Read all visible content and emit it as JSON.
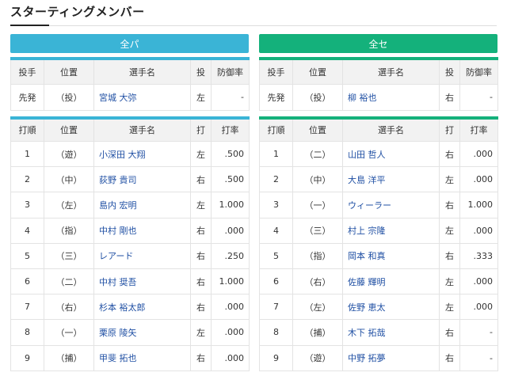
{
  "page": {
    "title": "スターティングメンバー"
  },
  "teams": [
    {
      "key": "pa",
      "name": "全パ",
      "pitcher": {
        "headers": [
          "投手",
          "位置",
          "選手名",
          "投",
          "防御率"
        ],
        "role": "先発",
        "position": "（投）",
        "name": "宮城 大弥",
        "throws": "左",
        "era": "-"
      },
      "batting": {
        "headers": [
          "打順",
          "位置",
          "選手名",
          "打",
          "打率"
        ],
        "rows": [
          {
            "order": "1",
            "position": "（遊）",
            "name": "小深田 大翔",
            "bats": "左",
            "avg": ".500"
          },
          {
            "order": "2",
            "position": "（中）",
            "name": "荻野 貴司",
            "bats": "右",
            "avg": ".500"
          },
          {
            "order": "3",
            "position": "（左）",
            "name": "島内 宏明",
            "bats": "左",
            "avg": "1.000"
          },
          {
            "order": "4",
            "position": "（指）",
            "name": "中村 剛也",
            "bats": "右",
            "avg": ".000"
          },
          {
            "order": "5",
            "position": "（三）",
            "name": "レアード",
            "bats": "右",
            "avg": ".250"
          },
          {
            "order": "6",
            "position": "（二）",
            "name": "中村 奨吾",
            "bats": "右",
            "avg": "1.000"
          },
          {
            "order": "7",
            "position": "（右）",
            "name": "杉本 裕太郎",
            "bats": "右",
            "avg": ".000"
          },
          {
            "order": "8",
            "position": "（一）",
            "name": "栗原 陵矢",
            "bats": "左",
            "avg": ".000"
          },
          {
            "order": "9",
            "position": "（捕）",
            "name": "甲斐 拓也",
            "bats": "右",
            "avg": ".000"
          }
        ]
      }
    },
    {
      "key": "se",
      "name": "全セ",
      "pitcher": {
        "headers": [
          "投手",
          "位置",
          "選手名",
          "投",
          "防御率"
        ],
        "role": "先発",
        "position": "（投）",
        "name": "柳 裕也",
        "throws": "右",
        "era": "-"
      },
      "batting": {
        "headers": [
          "打順",
          "位置",
          "選手名",
          "打",
          "打率"
        ],
        "rows": [
          {
            "order": "1",
            "position": "（二）",
            "name": "山田 哲人",
            "bats": "右",
            "avg": ".000"
          },
          {
            "order": "2",
            "position": "（中）",
            "name": "大島 洋平",
            "bats": "左",
            "avg": ".000"
          },
          {
            "order": "3",
            "position": "（一）",
            "name": "ウィーラー",
            "bats": "右",
            "avg": "1.000"
          },
          {
            "order": "4",
            "position": "（三）",
            "name": "村上 宗隆",
            "bats": "左",
            "avg": ".000"
          },
          {
            "order": "5",
            "position": "（指）",
            "name": "岡本 和真",
            "bats": "右",
            "avg": ".333"
          },
          {
            "order": "6",
            "position": "（右）",
            "name": "佐藤 輝明",
            "bats": "左",
            "avg": ".000"
          },
          {
            "order": "7",
            "position": "（左）",
            "name": "佐野 恵太",
            "bats": "左",
            "avg": ".000"
          },
          {
            "order": "8",
            "position": "（捕）",
            "name": "木下 拓哉",
            "bats": "右",
            "avg": "-"
          },
          {
            "order": "9",
            "position": "（遊）",
            "name": "中野 拓夢",
            "bats": "右",
            "avg": "-"
          }
        ]
      }
    }
  ]
}
